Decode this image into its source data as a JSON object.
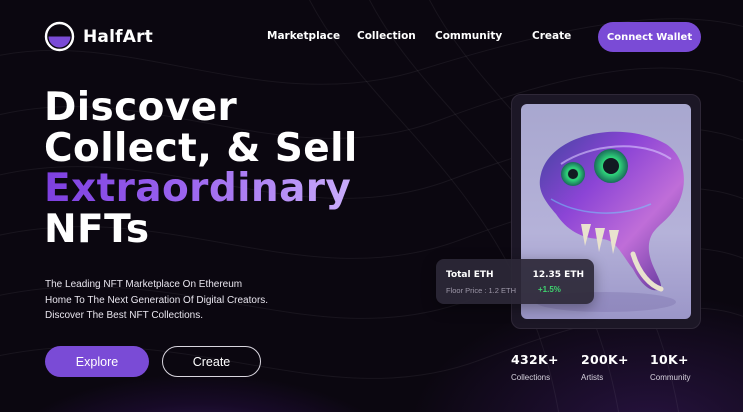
{
  "brand": {
    "name": "HalfArt"
  },
  "nav": {
    "items": [
      {
        "label": "Marketplace"
      },
      {
        "label": "Collection"
      },
      {
        "label": "Community"
      },
      {
        "label": "Create"
      }
    ],
    "connect_label": "Connect Wallet"
  },
  "hero": {
    "headline_line1": "Discover",
    "headline_line2": "Collect, & Sell",
    "headline_accent": "Extraordinary",
    "headline_line4": "NFTs",
    "description_lines": [
      "The Leading NFT Marketplace On Ethereum",
      "Home To The Next Generation Of Digital Creators.",
      "Discover The Best NFT Collections."
    ],
    "explore_label": "Explore",
    "create_label": "Create"
  },
  "nft_card": {
    "image_icon": "crystal-skull-artwork",
    "total_label": "Total ETH",
    "total_value": "12.35 ETH",
    "floor_label": "Floor Price : 1.2 ETH",
    "change_value": "+1.5%"
  },
  "stats": [
    {
      "value": "432K+",
      "label": "Collections"
    },
    {
      "value": "200K+",
      "label": "Artists"
    },
    {
      "value": "10K+",
      "label": "Community"
    }
  ],
  "colors": {
    "background": "#0b0710",
    "accent": "#7a4bd6",
    "positive": "#3fd36f"
  }
}
